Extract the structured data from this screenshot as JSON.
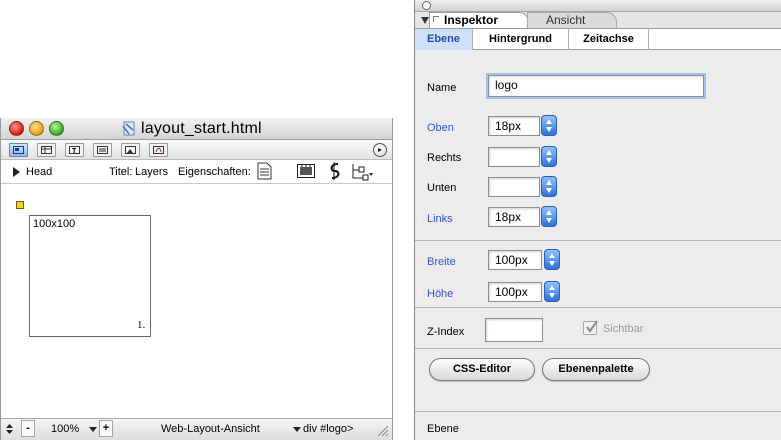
{
  "document_window": {
    "title": "layout_start.html",
    "head_label": "Head",
    "titel_label": "Titel:",
    "titel_value": "Layers",
    "eigenschaften_label": "Eigenschaften:",
    "layer": {
      "size_label": "100x100",
      "corner_marker": "1."
    },
    "statusbar": {
      "minus": "-",
      "zoom": "100%",
      "plus": "+",
      "view_mode": "Web-Layout-Ansicht",
      "tag_path": "div #logo>"
    }
  },
  "inspector": {
    "tabs": {
      "inspektor": "Inspektor",
      "ansicht": "Ansicht"
    },
    "subtabs": {
      "ebene": "Ebene",
      "hintergrund": "Hintergrund",
      "zeitachse": "Zeitachse"
    },
    "fields": {
      "name_label": "Name",
      "name_value": "logo",
      "oben_label": "Oben",
      "oben_value": "18px",
      "rechts_label": "Rechts",
      "rechts_value": "",
      "unten_label": "Unten",
      "unten_value": "",
      "links_label": "Links",
      "links_value": "18px",
      "breite_label": "Breite",
      "breite_value": "100px",
      "hoehe_label": "Höhe",
      "hoehe_value": "100px",
      "zindex_label": "Z-Index",
      "zindex_value": "",
      "sichtbar_label": "Sichtbar"
    },
    "buttons": {
      "css_editor": "CSS-Editor",
      "ebenenpalette": "Ebenenpalette"
    },
    "status": "Ebene"
  },
  "colors": {
    "link_blue": "#2f57d4",
    "selected_subtab": "#cfe0fb",
    "stepper_blue": "#2f73d8"
  },
  "icons": [
    "close-light-icon",
    "minimize-light-icon",
    "zoom-light-icon",
    "html-file-icon",
    "layout-view-icon",
    "table-view-icon",
    "text-view-icon",
    "list-view-icon",
    "image-view-icon",
    "pdf-view-icon",
    "preview-circle-icon",
    "page-icon",
    "film-icon",
    "link-icon",
    "tree-icon",
    "anchor-marker-icon",
    "resize-grip-icon",
    "checkmark-icon"
  ]
}
